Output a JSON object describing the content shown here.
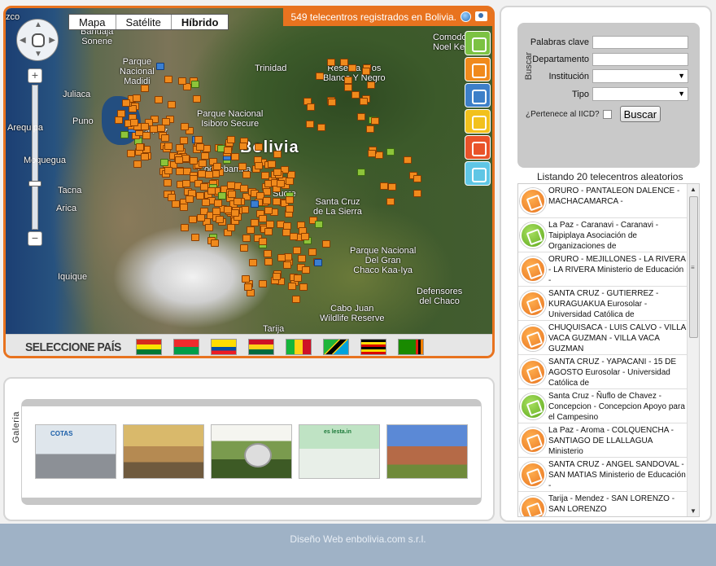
{
  "map": {
    "map_types": [
      "Mapa",
      "Satélite",
      "Híbrido"
    ],
    "active_map_type": "Híbrido",
    "count_banner": "549 telecentros registrados en Bolivia.",
    "labels": {
      "coco": "zco",
      "bahuaja": "Bahuaja\nSonene",
      "parque_madidi": "Parque\nNacional\nMadidi",
      "trinidad": "Trinidad",
      "reserva_rios": "Reserva Rios\nBlanco Y Negro",
      "comodoro": "Comodo\nNoel Kem",
      "juliaca": "Juliaca",
      "puno": "Puno",
      "la_paz": "La Paz",
      "isiboro": "Parque Nacional\nIsiboro Secure",
      "bolivia": "Bolivia",
      "arequipa": "Arequipa",
      "moquegua": "Moquegua",
      "cochabamba": "Cochabamba",
      "tacna": "Tacna",
      "arica": "Arica",
      "santa_cruz": "Santa Cruz\nde La Sierra",
      "sucre": "Sucre",
      "iquique": "Iquique",
      "gran_chaco": "Parque Nacional\nDel Gran\nChaco Kaa-Iya",
      "defensores": "Defensores\ndel Chaco",
      "cabo_juan": "Cabo Juan\nWildlife Reserve",
      "tarija": "Tarija"
    }
  },
  "country_bar": {
    "title": "SELECCIONE PAÍS"
  },
  "gallery": {
    "label": "Galeria",
    "thumb_texts": [
      "COTAS",
      "es lesta.in"
    ]
  },
  "search": {
    "section_label": "Buscar",
    "keyword_label": "Palabras clave",
    "keyword_value": "",
    "department_label": "Departamento",
    "department_value": "",
    "institution_label": "Institución",
    "type_label": "Tipo",
    "iicd_label": "¿Pertenece al IICD?",
    "button_label": "Buscar"
  },
  "list": {
    "header": "Listando 20 telecentros aleatorios",
    "items": [
      {
        "icon": "orange",
        "text": "ORURO - PANTALEON DALENCE - MACHACAMARCA -"
      },
      {
        "icon": "green",
        "text": "La Paz - Caranavi - Caranavi - Taipiplaya Asociación de Organizaciones de"
      },
      {
        "icon": "orange",
        "text": "ORURO - MEJILLONES - LA RIVERA - LA RIVERA Ministerio de Educación -"
      },
      {
        "icon": "orange",
        "text": "SANTA CRUZ - GUTIERREZ - KURAGUAKUA Eurosolar - Universidad Católica de"
      },
      {
        "icon": "orange",
        "text": "CHUQUISACA - LUIS CALVO - VILLA VACA GUZMAN - VILLA VACA GUZMAN"
      },
      {
        "icon": "orange",
        "text": "SANTA CRUZ - YAPACANI - 15 DE AGOSTO Eurosolar - Universidad Católica de"
      },
      {
        "icon": "green",
        "text": "Santa Cruz - Ñuflo de Chavez - Concepcion - Concepcion Apoyo para el Campesino"
      },
      {
        "icon": "orange",
        "text": "La Paz - Aroma - COLQUENCHA - SANTIAGO DE LLALLAGUA Ministerio"
      },
      {
        "icon": "orange",
        "text": "SANTA CRUZ - ANGEL SANDOVAL - SAN MATIAS Ministerio de Educación -"
      },
      {
        "icon": "orange",
        "text": "Tarija - Mendez - SAN LORENZO - SAN LORENZO"
      }
    ]
  },
  "footer": {
    "text": "Diseño Web enbolivia.com s.r.l."
  },
  "colors": {
    "accent": "#e8731f",
    "panel_border": "#d5d5d5",
    "page_bottom": "#9fb2c6"
  }
}
